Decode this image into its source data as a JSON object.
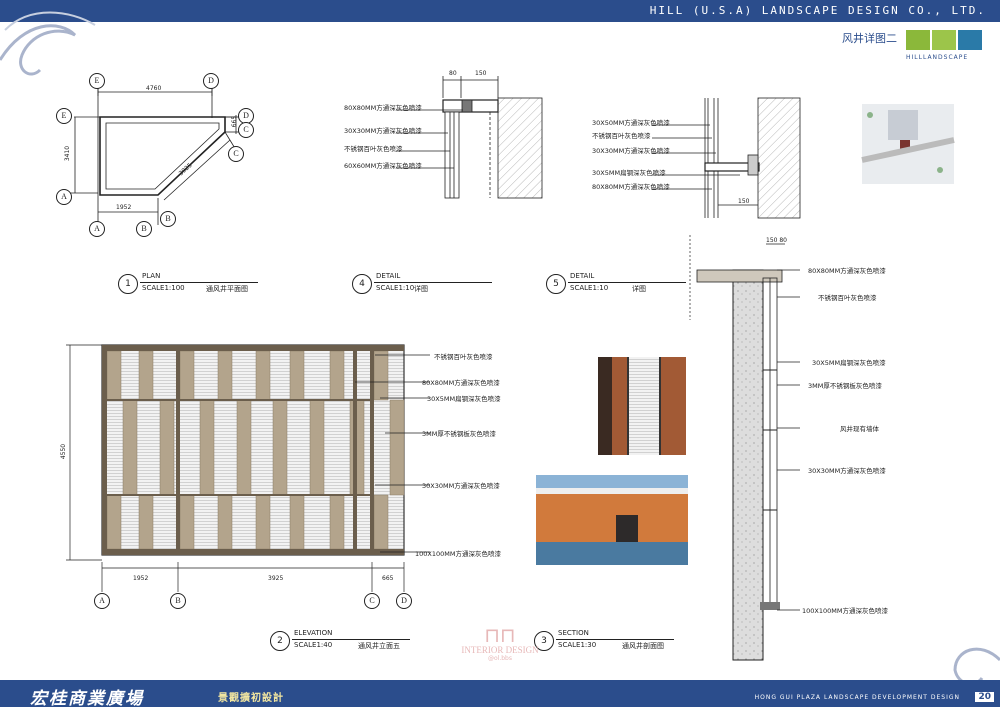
{
  "header": {
    "company": "HILL (U.S.A) LANDSCAPE  DESIGN CO., LTD.",
    "sheet_title": "风井详图二"
  },
  "logo": {
    "text": "HILLLANDSCAPE"
  },
  "footer": {
    "project_cn": "宏桂商業廣場",
    "subtitle_cn": "景觀擴初設計",
    "project_en": "HONG  GUI  PLAZA  LANDSCAPE DEVELOPMENT DESIGN",
    "page": "20"
  },
  "watermark": {
    "text": "INTERIOR DESIGN",
    "sub": "@ol.bbs"
  },
  "plan": {
    "title": {
      "num": "1",
      "name": "PLAN",
      "scale": "SCALE1:100",
      "cn": "通风井平面图"
    },
    "dims": {
      "top": "4760",
      "left": "3410",
      "bottom": "1952",
      "diag": "3925",
      "right": "665"
    },
    "grid": {
      "a": "A",
      "b": "B",
      "c": "C",
      "d": "D",
      "e": "E"
    }
  },
  "detail4": {
    "title": {
      "num": "4",
      "name": "DETAIL",
      "scale": "SCALE1:10",
      "cn": "详图"
    },
    "dims": [
      "80",
      "150"
    ],
    "labels": [
      "80X80MM方通深灰色喷漆",
      "30X30MM方通深灰色喷漆",
      "不锈钢百叶灰色喷漆",
      "60X60MM方通深灰色喷漆"
    ]
  },
  "detail5": {
    "title": {
      "num": "5",
      "name": "DETAIL",
      "scale": "SCALE1:10",
      "cn": "详图"
    },
    "dims": [
      "150"
    ],
    "labels": [
      "30X50MM方通深灰色喷漆",
      "不锈钢百叶灰色喷漆",
      "30X30MM方通深灰色喷漆",
      "30X5MM扁钢深灰色喷漆",
      "80X80MM方通深灰色喷漆"
    ]
  },
  "elevation": {
    "title": {
      "num": "2",
      "name": "ELEVATION",
      "scale": "SCALE1:40",
      "cn": "通风井立面五"
    },
    "height": "4550",
    "dims": [
      "1952",
      "3925",
      "665"
    ],
    "grid": [
      "A",
      "B",
      "C",
      "D"
    ],
    "labels": [
      "不锈钢百叶灰色喷漆",
      "80X80MM方通深灰色喷漆",
      "30X5MM扁钢深灰色喷漆",
      "3MM厚不锈钢板灰色喷漆",
      "30X30MM方通深灰色喷漆",
      "100X100MM方通深灰色喷漆"
    ]
  },
  "section": {
    "title": {
      "num": "3",
      "name": "SECTION",
      "scale": "SCALE1:30",
      "cn": "通风井剖面图"
    },
    "dims": "150 80",
    "labels": [
      "80X80MM方通深灰色喷漆",
      "不锈钢百叶灰色喷漆",
      "30X5MM扁钢深灰色喷漆",
      "3MM厚不锈钢板灰色喷漆",
      "风井现有墙体",
      "30X30MM方通深灰色喷漆",
      "100X100MM方通深灰色喷漆"
    ]
  },
  "colors": {
    "brand": "#2b4d8c",
    "panel": "#b3a48c",
    "louver": "#f2f2f2",
    "frame": "#6b5e4c"
  }
}
